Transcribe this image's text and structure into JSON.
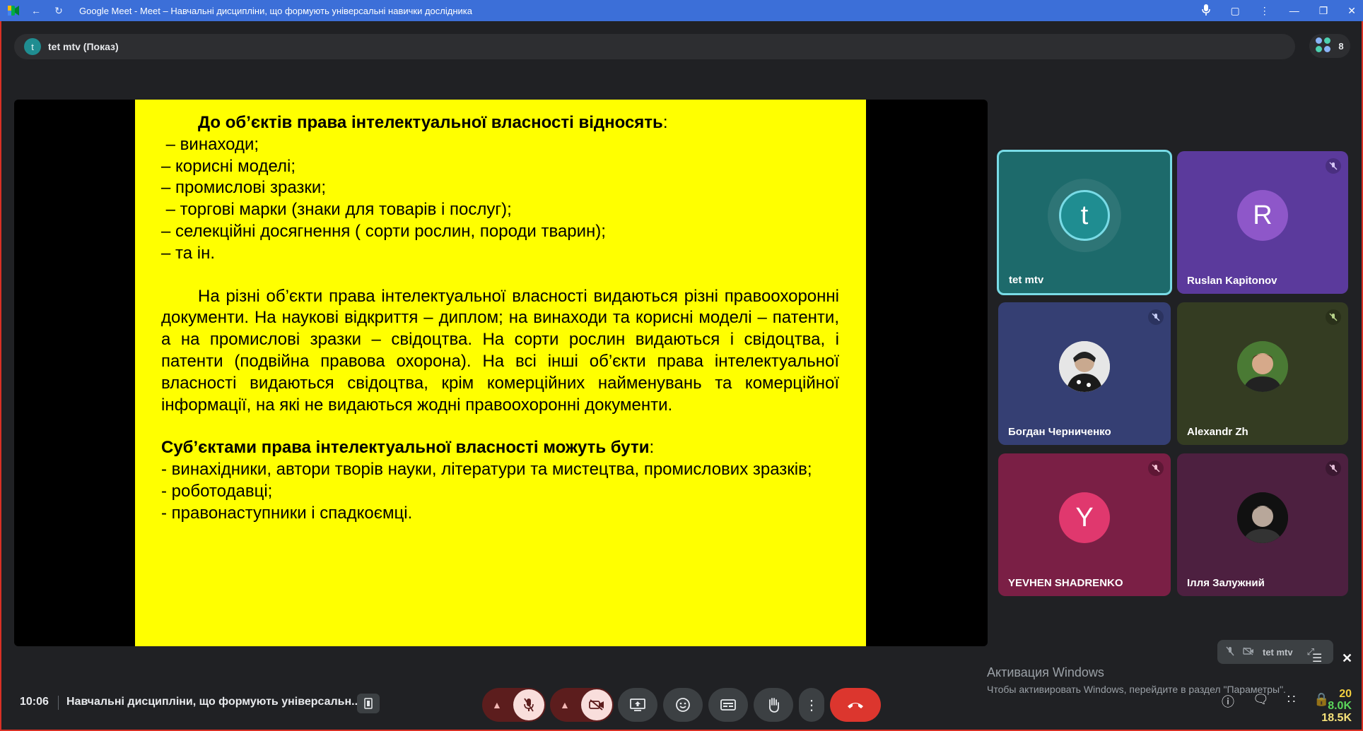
{
  "browser": {
    "title": "Google Meet - Meet – Навчальні дисципліни, що формують універсальні навички дослідника"
  },
  "presenter": {
    "initial": "t",
    "label": "tet mtv (Показ)",
    "participants_count": "8"
  },
  "slide": {
    "heading_bold": "До об’єктів права інтелектуальної власності відносять",
    "heading_tail": ":",
    "list1": [
      " – винаходи;",
      "– корисні моделі;",
      "– промислові зразки;",
      " – торгові марки (знаки для товарів і послуг);",
      "– селекційні досягнення ( сорти рослин, породи тварин);",
      "– та ін."
    ],
    "paragraph": "На різні об’єкти права інтелектуальної власності видаються різні правоохоронні документи. На наукові відкриття – диплом; на винаходи та корисні моделі – патенти, а на промислові зразки – свідоцтва. На сорти рослин видаються і свідоцтва, і патенти (подвійна правова охорона). На всі інші об’єкти права інтелектуальної власності видаються свідоцтва, крім комерційних найменувань та комерційної інформації, на які не видаються жодні правоохоронні документи.",
    "subjects_bold": "Суб’єктами права інтелектуальної власності можуть бути",
    "subjects_tail": ":",
    "list2": [
      "- винахідники, автори творів науки, літератури та мистецтва, промислових зразків;",
      "- роботодавці;",
      "- правонаступники і спадкоємці."
    ]
  },
  "participants": [
    {
      "name": "tet mtv",
      "initial": "t",
      "bg": "#1d6a6b",
      "avatar": "#1f8d91"
    },
    {
      "name": "Ruslan Kapitonov",
      "initial": "R",
      "bg": "#5b3a9c",
      "avatar": "#8e57c9"
    },
    {
      "name": "Богдан Черниченко",
      "initial": "",
      "bg": "#353f73"
    },
    {
      "name": "Alexandr Zh",
      "initial": "",
      "bg": "#343c22"
    },
    {
      "name": "YEVHEN SHADRENKO",
      "initial": "Y",
      "bg": "#7a1f45",
      "avatar": "#e0386e"
    },
    {
      "name": "Ілля Залужний",
      "initial": "",
      "bg": "#4d2040"
    }
  ],
  "self_view": {
    "name": "tet mtv"
  },
  "windows_watermark": {
    "title": "Активация Windows",
    "subtitle": "Чтобы активировать Windows, перейдите в раздел \"Параметры\"."
  },
  "bottom": {
    "time": "10:06",
    "meeting_name": "Навчальні дисципліни, що формують універсальн..."
  },
  "netinfo": {
    "a": "20",
    "b": "8.0K",
    "c": "18.5K"
  },
  "colors": {
    "accent": "#3c6fd8",
    "slide_bg": "#ffff00",
    "end_call": "#dc362e"
  }
}
